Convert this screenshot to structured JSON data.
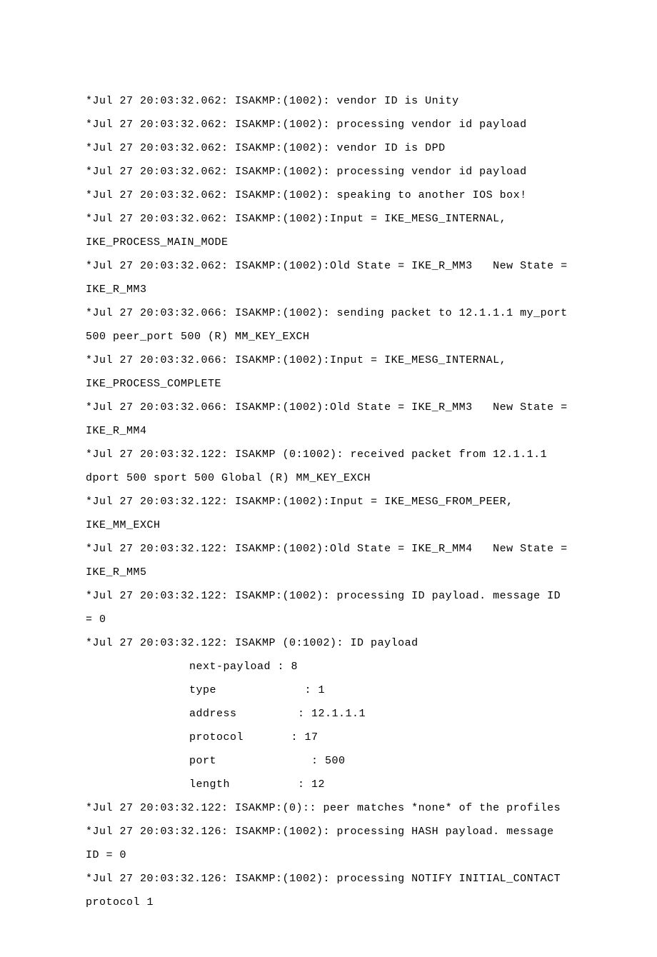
{
  "lines": [
    {
      "text": "*Jul 27 20:03:32.062: ISAKMP:(1002): vendor ID is Unity"
    },
    {
      "text": "*Jul 27 20:03:32.062: ISAKMP:(1002): processing vendor id payload"
    },
    {
      "text": "*Jul 27 20:03:32.062: ISAKMP:(1002): vendor ID is DPD"
    },
    {
      "text": "*Jul 27 20:03:32.062: ISAKMP:(1002): processing vendor id payload"
    },
    {
      "text": "*Jul 27 20:03:32.062: ISAKMP:(1002): speaking to another IOS box!"
    },
    {
      "text": "*Jul 27 20:03:32.062: ISAKMP:(1002):Input = IKE_MESG_INTERNAL, IKE_PROCESS_MAIN_MODE"
    },
    {
      "text": "*Jul 27 20:03:32.062: ISAKMP:(1002):Old State = IKE_R_MM3   New State = IKE_R_MM3"
    },
    {
      "text": "*Jul 27 20:03:32.066: ISAKMP:(1002): sending packet to 12.1.1.1 my_port 500 peer_port 500 (R) MM_KEY_EXCH"
    },
    {
      "text": "*Jul 27 20:03:32.066: ISAKMP:(1002):Input = IKE_MESG_INTERNAL, IKE_PROCESS_COMPLETE"
    },
    {
      "text": "*Jul 27 20:03:32.066: ISAKMP:(1002):Old State = IKE_R_MM3   New State = IKE_R_MM4"
    },
    {
      "text": "*Jul 27 20:03:32.122: ISAKMP (0:1002): received packet from 12.1.1.1 dport 500 sport 500 Global (R) MM_KEY_EXCH"
    },
    {
      "text": "*Jul 27 20:03:32.122: ISAKMP:(1002):Input = IKE_MESG_FROM_PEER, IKE_MM_EXCH"
    },
    {
      "text": "*Jul 27 20:03:32.122: ISAKMP:(1002):Old State = IKE_R_MM4   New State = IKE_R_MM5"
    },
    {
      "text": "*Jul 27 20:03:32.122: ISAKMP:(1002): processing ID payload. message ID = 0"
    },
    {
      "text": "*Jul 27 20:03:32.122: ISAKMP (0:1002): ID payload"
    },
    {
      "text": "next-payload : 8",
      "indent": true
    },
    {
      "text": "type             : 1",
      "indent": true
    },
    {
      "text": "address         : 12.1.1.1",
      "indent": true
    },
    {
      "text": "protocol       : 17",
      "indent": true
    },
    {
      "text": "port              : 500",
      "indent": true
    },
    {
      "text": "length          : 12",
      "indent": true
    },
    {
      "text": "*Jul 27 20:03:32.122: ISAKMP:(0):: peer matches *none* of the profiles"
    },
    {
      "text": "*Jul 27 20:03:32.126: ISAKMP:(1002): processing HASH payload. message ID = 0"
    },
    {
      "text": "*Jul 27 20:03:32.126: ISAKMP:(1002): processing NOTIFY INITIAL_CONTACT protocol 1"
    }
  ]
}
